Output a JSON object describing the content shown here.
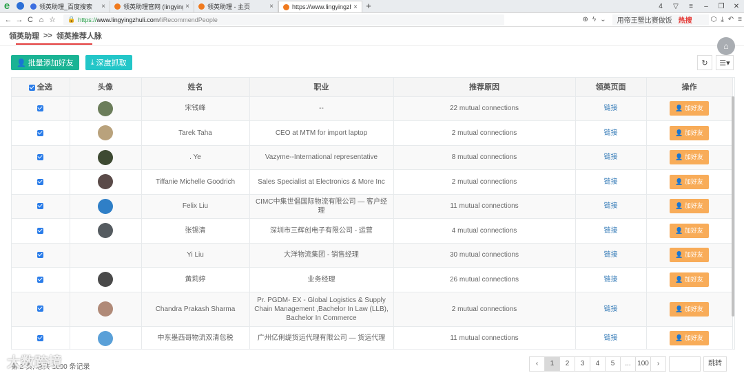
{
  "browser": {
    "tabs": [
      {
        "label": "领英助理_百度搜索",
        "color": "#3c6ee0"
      },
      {
        "label": "领英助理官网 (lingyingzhuli...",
        "color": "#f07a1e"
      },
      {
        "label": "领英助理 - 主页",
        "color": "#f07a1e"
      },
      {
        "label": "https://www.lingyingzhuli.co...",
        "color": "#f07a1e"
      }
    ],
    "url_scheme": "https://",
    "url_domain": "www.lingyingzhuli.com",
    "url_path": "/liRecommendPeople",
    "search_text": "用帝王蟹比赛做饭",
    "search_hot": "热搜",
    "tab_count": "4"
  },
  "breadcrumb": {
    "root": "领英助理",
    "sep": ">>",
    "current": "领英推荐人脉"
  },
  "toolbar": {
    "batch_add": "批量添加好友",
    "deep_fetch": "深度抓取"
  },
  "table": {
    "headers": {
      "select_all": "全选",
      "avatar": "头像",
      "name": "姓名",
      "job": "职业",
      "reason": "推荐原因",
      "page": "领英页面",
      "action": "操作"
    },
    "link_label": "链接",
    "add_label": "加好友",
    "rows": [
      {
        "name": "宋钱峰",
        "job": "--",
        "reason": "22 mutual connections",
        "avatar": "#6b7d5a"
      },
      {
        "name": "Tarek Taha",
        "job": "CEO at MTM for import laptop",
        "reason": "2 mutual connections",
        "avatar": "#b9a27c"
      },
      {
        "name": ". Ye",
        "job": "Vazyme--International representative",
        "reason": "8 mutual connections",
        "avatar": "#3e4a32"
      },
      {
        "name": "Tiffanie Michelle Goodrich",
        "job": "Sales Specialist at Electronics & More Inc",
        "reason": "2 mutual connections",
        "avatar": "#5a4a48"
      },
      {
        "name": "Felix Liu",
        "job": "CIMC中集世倡国际物流有限公司 — 客户经理",
        "reason": "11 mutual connections",
        "avatar": "#2f7fc7"
      },
      {
        "name": "张锡清",
        "job": "深圳市三辉创电子有限公司 - 运营",
        "reason": "4 mutual connections",
        "avatar": "#555b60"
      },
      {
        "name": "Yi Liu",
        "job": "大洋物流集团 - 销售经理",
        "reason": "30 mutual connections",
        "avatar": ""
      },
      {
        "name": "黄莉婷",
        "job": "业务经理",
        "reason": "26 mutual connections",
        "avatar": "#4a4a4a"
      },
      {
        "name": "Chandra Prakash Sharma",
        "job": "Pr. PGDM- EX - Global Logistics & Supply Chain Management ,Bachelor In Law (LLB), Bachelor In Commerce",
        "reason": "2 mutual connections",
        "avatar": "#b08a78"
      },
      {
        "name": "中东墨西哥物流双清包税",
        "job": "广州亿俐缇货运代理有限公司 — 货运代理",
        "reason": "11 mutual connections",
        "avatar": "#5aa0d8"
      }
    ]
  },
  "footer": {
    "info": "第 2 页, 总共 1000 条记录",
    "pages": [
      "‹",
      "1",
      "2",
      "3",
      "4",
      "5",
      "...",
      "100",
      "›"
    ],
    "active_page": "1",
    "jump": "跳转"
  },
  "watermark": "大数跨境"
}
